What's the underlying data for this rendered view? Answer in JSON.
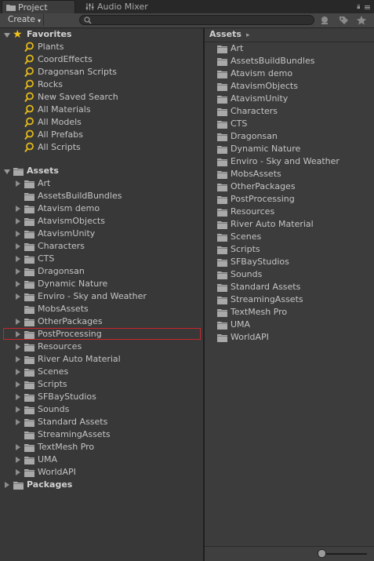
{
  "tabs": {
    "project": "Project",
    "audio_mixer": "Audio Mixer"
  },
  "toolbar": {
    "create_label": "Create",
    "create_caret": "▾",
    "search_placeholder": ""
  },
  "favorites": {
    "label": "Favorites",
    "items": [
      "Plants",
      "CoordEffects",
      "Dragonsan Scripts",
      "Rocks",
      "New Saved Search",
      "All Materials",
      "All Models",
      "All Prefabs",
      "All Scripts"
    ]
  },
  "assets_tree": {
    "label": "Assets",
    "selected": "PostProcessing",
    "items": [
      {
        "label": "Art",
        "expandable": true
      },
      {
        "label": "AssetsBuildBundles",
        "expandable": false
      },
      {
        "label": "Atavism demo",
        "expandable": true
      },
      {
        "label": "AtavismObjects",
        "expandable": true
      },
      {
        "label": "AtavismUnity",
        "expandable": true
      },
      {
        "label": "Characters",
        "expandable": true
      },
      {
        "label": "CTS",
        "expandable": true
      },
      {
        "label": "Dragonsan",
        "expandable": true
      },
      {
        "label": "Dynamic Nature",
        "expandable": true
      },
      {
        "label": "Enviro - Sky and Weather",
        "expandable": true
      },
      {
        "label": "MobsAssets",
        "expandable": false
      },
      {
        "label": "OtherPackages",
        "expandable": true
      },
      {
        "label": "PostProcessing",
        "expandable": true
      },
      {
        "label": "Resources",
        "expandable": true
      },
      {
        "label": "River Auto Material",
        "expandable": true
      },
      {
        "label": "Scenes",
        "expandable": true
      },
      {
        "label": "Scripts",
        "expandable": true
      },
      {
        "label": "SFBayStudios",
        "expandable": true
      },
      {
        "label": "Sounds",
        "expandable": true
      },
      {
        "label": "Standard Assets",
        "expandable": true
      },
      {
        "label": "StreamingAssets",
        "expandable": false
      },
      {
        "label": "TextMesh Pro",
        "expandable": true
      },
      {
        "label": "UMA",
        "expandable": true
      },
      {
        "label": "WorldAPI",
        "expandable": true
      }
    ]
  },
  "packages": {
    "label": "Packages"
  },
  "right_panel": {
    "breadcrumb": "Assets",
    "breadcrumb_arrow": "▸",
    "items": [
      "Art",
      "AssetsBuildBundles",
      "Atavism demo",
      "AtavismObjects",
      "AtavismUnity",
      "Characters",
      "CTS",
      "Dragonsan",
      "Dynamic Nature",
      "Enviro - Sky and Weather",
      "MobsAssets",
      "OtherPackages",
      "PostProcessing",
      "Resources",
      "River Auto Material",
      "Scenes",
      "Scripts",
      "SFBayStudios",
      "Sounds",
      "Standard Assets",
      "StreamingAssets",
      "TextMesh Pro",
      "UMA",
      "WorldAPI"
    ]
  },
  "colors": {
    "selection_outline": "#c8262d",
    "favorite_star": "#f3c31a",
    "search_icon": "#e2b81b"
  }
}
